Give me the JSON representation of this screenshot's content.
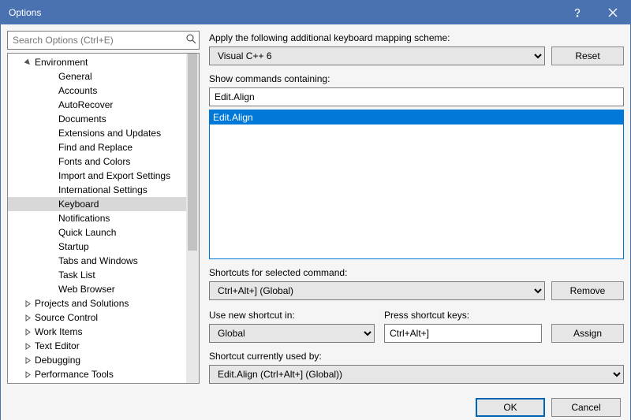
{
  "title": "Options",
  "search": {
    "placeholder": "Search Options (Ctrl+E)"
  },
  "tree": {
    "root": "Environment",
    "children": [
      "General",
      "Accounts",
      "AutoRecover",
      "Documents",
      "Extensions and Updates",
      "Find and Replace",
      "Fonts and Colors",
      "Import and Export Settings",
      "International Settings",
      "Keyboard",
      "Notifications",
      "Quick Launch",
      "Startup",
      "Tabs and Windows",
      "Task List",
      "Web Browser"
    ],
    "collapsed": [
      "Projects and Solutions",
      "Source Control",
      "Work Items",
      "Text Editor",
      "Debugging",
      "Performance Tools"
    ],
    "selected": "Keyboard"
  },
  "pane": {
    "mapping_label": "Apply the following additional keyboard mapping scheme:",
    "mapping_value": "Visual C++ 6",
    "reset": "Reset",
    "show_label": "Show commands containing:",
    "show_value": "Edit.Align",
    "list_selected": "Edit.Align",
    "shortcuts_label": "Shortcuts for selected command:",
    "shortcuts_value": "Ctrl+Alt+] (Global)",
    "remove": "Remove",
    "use_in_label": "Use new shortcut in:",
    "use_in_value": "Global",
    "press_label": "Press shortcut keys:",
    "press_value": "Ctrl+Alt+]",
    "assign": "Assign",
    "used_by_label": "Shortcut currently used by:",
    "used_by_value": "Edit.Align (Ctrl+Alt+] (Global))"
  },
  "footer": {
    "ok": "OK",
    "cancel": "Cancel"
  }
}
